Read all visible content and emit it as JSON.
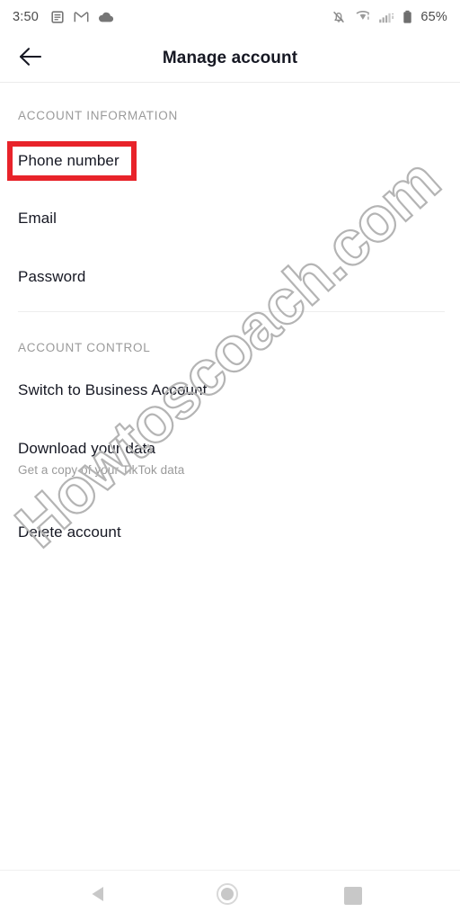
{
  "status_bar": {
    "time": "3:50",
    "left_icons": [
      "news-feed-icon",
      "gmail-icon",
      "cloud-icon"
    ],
    "right_icons": [
      "notifications-off-icon",
      "wifi-icon",
      "cellular-signal-icon",
      "battery-icon"
    ],
    "battery_percent": "65%"
  },
  "header": {
    "back_icon": "arrow-left-icon",
    "title": "Manage account"
  },
  "sections": [
    {
      "label": "ACCOUNT INFORMATION",
      "rows": [
        {
          "title": "Phone number",
          "subtitle": "",
          "highlighted": true
        },
        {
          "title": "Email",
          "subtitle": "",
          "highlighted": false
        },
        {
          "title": "Password",
          "subtitle": "",
          "highlighted": false
        }
      ]
    },
    {
      "label": "ACCOUNT CONTROL",
      "rows": [
        {
          "title": "Switch to Business Account",
          "subtitle": "",
          "highlighted": false
        },
        {
          "title": "Download your data",
          "subtitle": "Get a copy of your TikTok data",
          "highlighted": false
        },
        {
          "title": "Delete account",
          "subtitle": "",
          "highlighted": false
        }
      ]
    }
  ],
  "annotation": {
    "highlight_color": "#e8232a",
    "target": "Phone number"
  },
  "watermark": {
    "text": "Howtoscoach.com",
    "color": "#b4b4b4"
  },
  "nav_bar": {
    "back_icon": "triangle-back-icon",
    "home_icon": "circle-home-icon",
    "recents_icon": "square-recents-icon"
  }
}
